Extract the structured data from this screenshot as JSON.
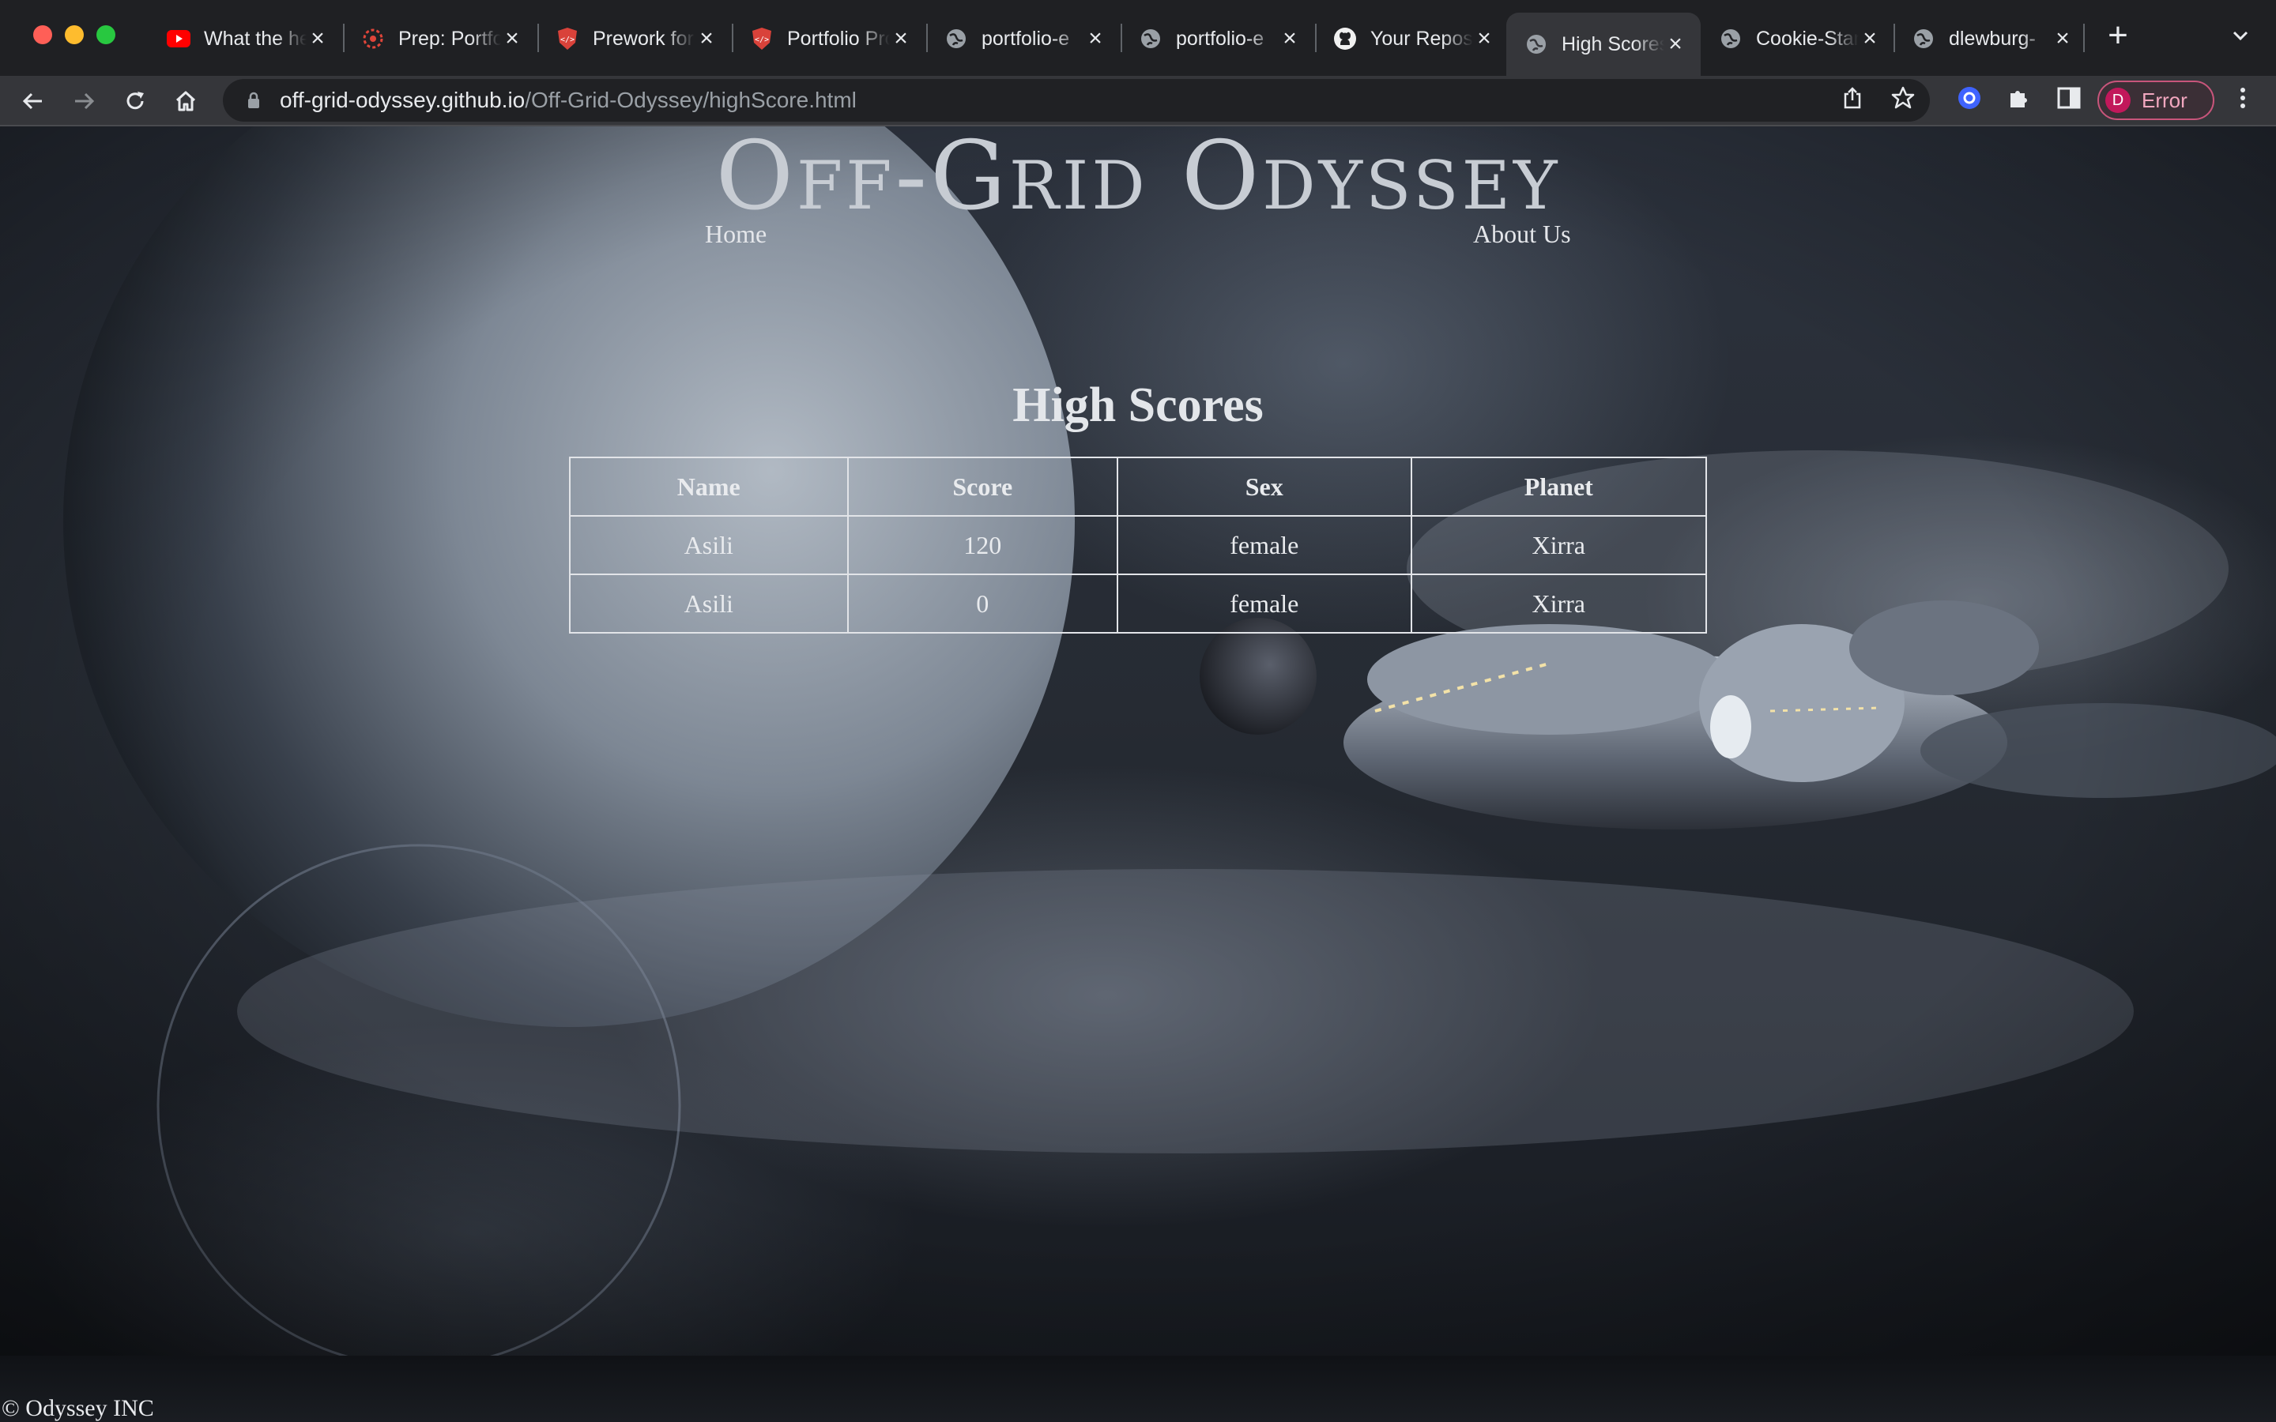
{
  "browser": {
    "tabs": [
      {
        "title": "What the heck",
        "icon": "youtube-icon"
      },
      {
        "title": "Prep: Portfolio",
        "icon": "codefellows-icon"
      },
      {
        "title": "Prework for",
        "icon": "codefellows-shield-icon"
      },
      {
        "title": "Portfolio Project",
        "icon": "codefellows-shield-icon"
      },
      {
        "title": "portfolio-e",
        "icon": "globe-icon"
      },
      {
        "title": "portfolio-e",
        "icon": "globe-icon"
      },
      {
        "title": "Your Repositories",
        "icon": "github-icon"
      },
      {
        "title": "High Scores",
        "icon": "globe-icon",
        "active": true
      },
      {
        "title": "Cookie-Stand",
        "icon": "globe-icon"
      },
      {
        "title": "dlewburg-",
        "icon": "globe-icon"
      }
    ],
    "url_host": "off-grid-odyssey.github.io",
    "url_path": "/Off-Grid-Odyssey/highScore.html",
    "profile_initial": "D",
    "profile_status": "Error",
    "colors": {
      "tabstrip": "#1f2023",
      "toolbar": "#35363a",
      "omnibox": "#202124",
      "profile": "#c2185b"
    }
  },
  "site": {
    "title": "Off-Grid Odyssey",
    "nav": {
      "home": "Home",
      "about": "About Us"
    },
    "section_title": "High Scores",
    "table": {
      "headers": [
        "Name",
        "Score",
        "Sex",
        "Planet"
      ],
      "rows": [
        [
          "Asili",
          "120",
          "female",
          "Xirra"
        ],
        [
          "Asili",
          "0",
          "female",
          "Xirra"
        ]
      ]
    },
    "footer": "© Odyssey INC"
  }
}
